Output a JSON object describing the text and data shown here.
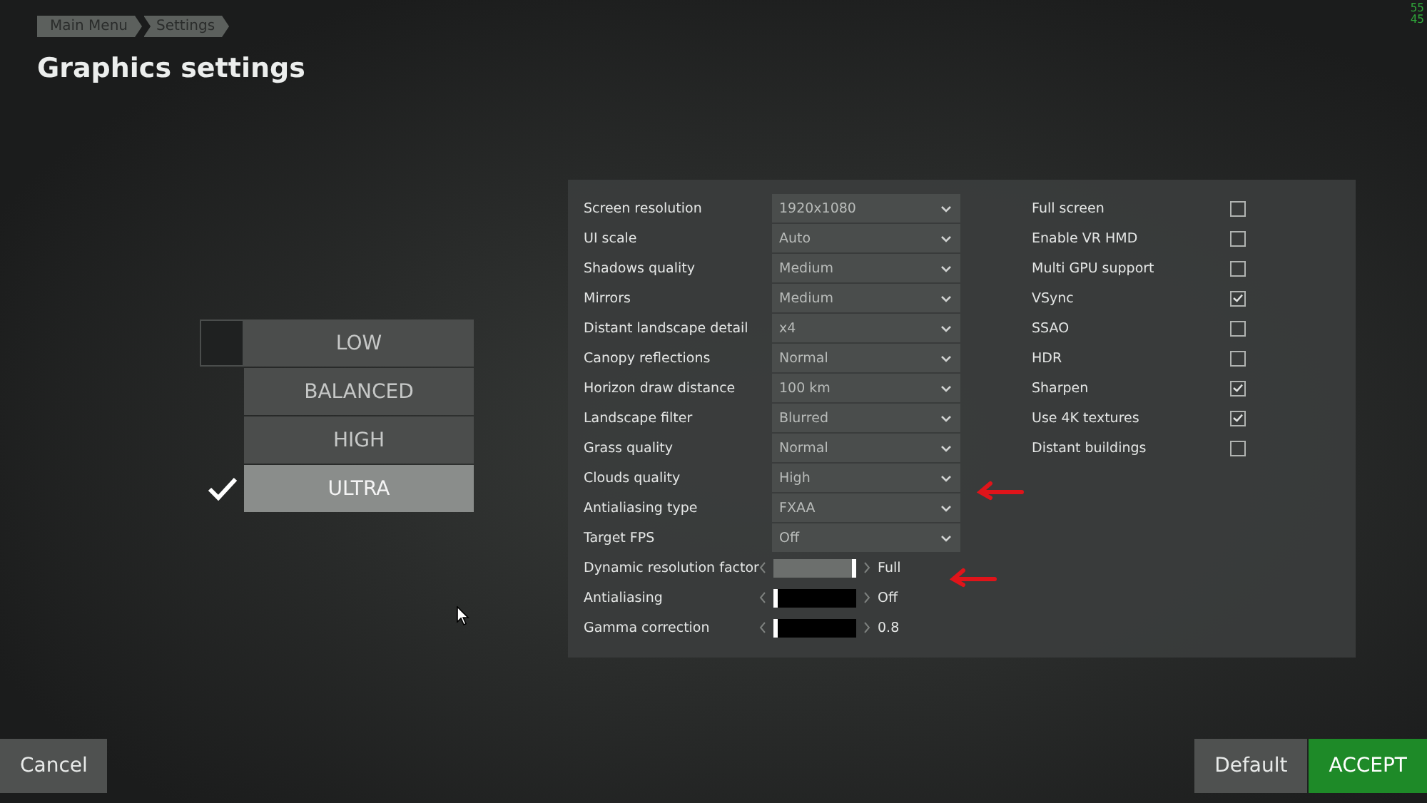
{
  "breadcrumb": [
    {
      "label": "Main Menu"
    },
    {
      "label": "Settings"
    }
  ],
  "title": "Graphics settings",
  "fps_counter": [
    "55",
    "45"
  ],
  "presets": [
    {
      "label": "LOW",
      "selected": false
    },
    {
      "label": "BALANCED",
      "selected": false
    },
    {
      "label": "HIGH",
      "selected": false
    },
    {
      "label": "ULTRA",
      "selected": true
    }
  ],
  "dropdowns": [
    {
      "label": "Screen resolution",
      "value": "1920x1080"
    },
    {
      "label": "UI scale",
      "value": "Auto"
    },
    {
      "label": "Shadows quality",
      "value": "Medium"
    },
    {
      "label": "Mirrors",
      "value": "Medium"
    },
    {
      "label": "Distant landscape detail",
      "value": "x4"
    },
    {
      "label": "Canopy reflections",
      "value": "Normal"
    },
    {
      "label": "Horizon draw distance",
      "value": "100 km"
    },
    {
      "label": "Landscape filter",
      "value": "Blurred"
    },
    {
      "label": "Grass quality",
      "value": "Normal"
    },
    {
      "label": "Clouds quality",
      "value": "High"
    },
    {
      "label": "Antialiasing type",
      "value": "FXAA"
    },
    {
      "label": "Target FPS",
      "value": "Off"
    }
  ],
  "sliders": [
    {
      "label": "Dynamic resolution factor",
      "level": 1,
      "reading": "Full"
    },
    {
      "label": "Antialiasing",
      "level": 0,
      "reading": "Off"
    },
    {
      "label": "Gamma correction",
      "level": 0,
      "reading": "0.8"
    }
  ],
  "checkboxes": [
    {
      "label": "Full screen",
      "checked": false
    },
    {
      "label": "Enable VR HMD",
      "checked": false
    },
    {
      "label": "Multi GPU support",
      "checked": false
    },
    {
      "label": "VSync",
      "checked": true
    },
    {
      "label": "SSAO",
      "checked": false
    },
    {
      "label": "HDR",
      "checked": false
    },
    {
      "label": "Sharpen",
      "checked": true
    },
    {
      "label": "Use 4K textures",
      "checked": true
    },
    {
      "label": "Distant buildings",
      "checked": false
    }
  ],
  "buttons": {
    "cancel": "Cancel",
    "default": "Default",
    "accept": "ACCEPT"
  }
}
